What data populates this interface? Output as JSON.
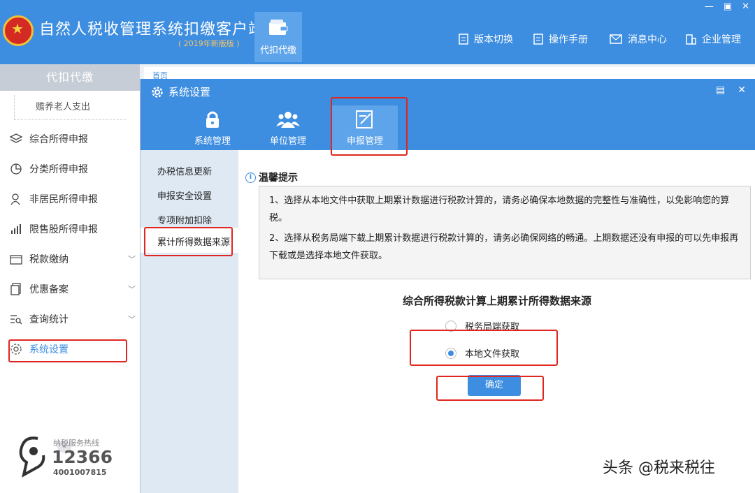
{
  "app": {
    "title": "自然人税收管理系统扣缴客户端",
    "edition": "( 2019年新版版 )",
    "main_tab": "代扣代缴",
    "nav": [
      "版本切换",
      "操作手册",
      "消息中心",
      "企业管理"
    ]
  },
  "sidebar": {
    "header": "代扣代缴",
    "sub_item": "赡养老人支出",
    "items": [
      "综合所得申报",
      "分类所得申报",
      "非居民所得申报",
      "限售股所得申报",
      "税款缴纳",
      "优惠备案",
      "查询统计",
      "系统设置"
    ],
    "collapse": "«",
    "hotline_label": "纳税服务热线",
    "hotline_number": "12366",
    "hotline_sub": "4001007815"
  },
  "background_tab": "首页",
  "dialog": {
    "title": "系统设置",
    "tabs": [
      "系统管理",
      "单位管理",
      "申报管理"
    ],
    "menu": [
      "办税信息更新",
      "申报安全设置",
      "专项附加扣除",
      "累计所得数据来源"
    ],
    "tip_title": "温馨提示",
    "tips": [
      "1、选择从本地文件中获取上期累计数据进行税款计算的，请务必确保本地数据的完整性与准确性，以免影响您的算税。",
      "2、选择从税务局端下载上期累计数据进行税款计算的，请务必确保网络的畅通。上期数据还没有申报的可以先申报再下载或是选择本地文件获取。"
    ],
    "question": "综合所得税款计算上期累计所得数据来源",
    "options": [
      "税务局端获取",
      "本地文件获取"
    ],
    "selected_option": "本地文件获取",
    "confirm": "确定"
  },
  "watermark": "头条 @税来税往",
  "colors": {
    "primary": "#3d8de0",
    "highlight": "#e0261f"
  }
}
